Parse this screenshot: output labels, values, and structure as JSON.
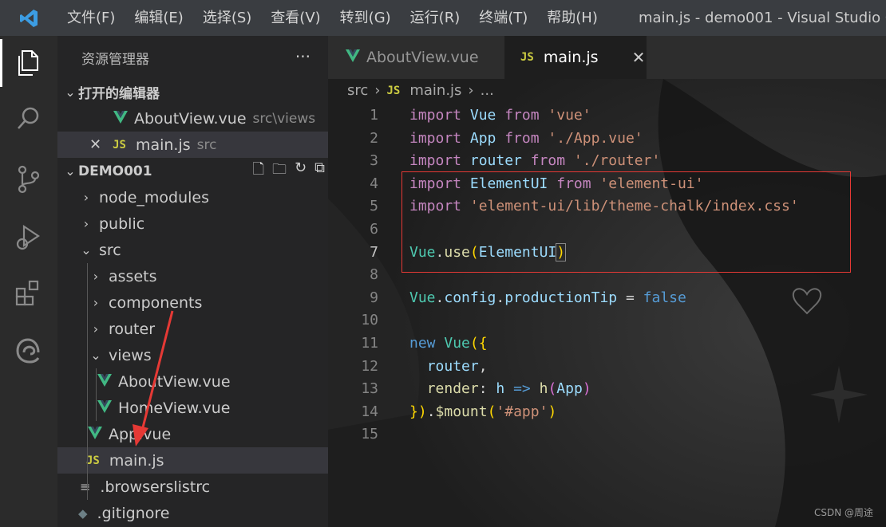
{
  "titlebar": {
    "menus": [
      "文件(F)",
      "编辑(E)",
      "选择(S)",
      "查看(V)",
      "转到(G)",
      "运行(R)",
      "终端(T)",
      "帮助(H)"
    ],
    "title": "main.js - demo001 - Visual Studio Code"
  },
  "activity_bar": {
    "icons": [
      "explorer-icon",
      "search-icon",
      "source-control-icon",
      "run-debug-icon",
      "extensions-icon",
      "edge-icon"
    ]
  },
  "sidebar": {
    "header": "资源管理器",
    "more": "···",
    "open_editors": {
      "title": "打开的编辑器",
      "items": [
        {
          "name": "AboutView.vue",
          "path": "src\\views"
        },
        {
          "name": "main.js",
          "path": "src"
        }
      ]
    },
    "project": {
      "title": "DEMO001",
      "tree": [
        {
          "label": "node_modules",
          "type": "folder",
          "state": "collapsed"
        },
        {
          "label": "public",
          "type": "folder",
          "state": "collapsed"
        },
        {
          "label": "src",
          "type": "folder",
          "state": "expanded"
        },
        {
          "label": "assets",
          "type": "folder",
          "state": "collapsed"
        },
        {
          "label": "components",
          "type": "folder",
          "state": "collapsed"
        },
        {
          "label": "router",
          "type": "folder",
          "state": "collapsed"
        },
        {
          "label": "views",
          "type": "folder",
          "state": "expanded"
        },
        {
          "label": "AboutView.vue",
          "type": "vue"
        },
        {
          "label": "HomeView.vue",
          "type": "vue"
        },
        {
          "label": "App.vue",
          "type": "vue"
        },
        {
          "label": "main.js",
          "type": "js"
        },
        {
          "label": ".browserslistrc",
          "type": "file"
        },
        {
          "label": ".gitignore",
          "type": "git"
        }
      ]
    }
  },
  "tabs": [
    {
      "label": "AboutView.vue",
      "active": false
    },
    {
      "label": "main.js",
      "active": true,
      "close": "✕"
    }
  ],
  "breadcrumb": {
    "folder": "src",
    "file": "main.js",
    "tail": "..."
  },
  "code_lines": [
    {
      "n": "1",
      "tokens": [
        [
          "kw",
          "import "
        ],
        [
          "vb",
          "Vue "
        ],
        [
          "kw",
          "from "
        ],
        [
          "str",
          "'vue'"
        ]
      ]
    },
    {
      "n": "2",
      "tokens": [
        [
          "kw",
          "import "
        ],
        [
          "vb",
          "App "
        ],
        [
          "kw",
          "from "
        ],
        [
          "str",
          "'./App.vue'"
        ]
      ]
    },
    {
      "n": "3",
      "tokens": [
        [
          "kw",
          "import "
        ],
        [
          "vb",
          "router "
        ],
        [
          "kw",
          "from "
        ],
        [
          "str",
          "'./router'"
        ]
      ]
    },
    {
      "n": "4",
      "tokens": [
        [
          "kw",
          "import "
        ],
        [
          "vb",
          "ElementUI "
        ],
        [
          "kw",
          "from "
        ],
        [
          "str",
          "'element-ui'"
        ]
      ]
    },
    {
      "n": "5",
      "tokens": [
        [
          "kw",
          "import "
        ],
        [
          "str",
          "'element-ui/lib/theme-chalk/index.css'"
        ]
      ]
    },
    {
      "n": "6",
      "tokens": []
    },
    {
      "n": "7",
      "tokens": [
        [
          "cls",
          "Vue"
        ],
        [
          "pn",
          "."
        ],
        [
          "fn",
          "use"
        ],
        [
          "br",
          "("
        ],
        [
          "vb",
          "ElementUI"
        ],
        [
          "br",
          "@)"
        ]
      ]
    },
    {
      "n": "8",
      "tokens": []
    },
    {
      "n": "9",
      "tokens": [
        [
          "cls",
          "Vue"
        ],
        [
          "pn",
          "."
        ],
        [
          "vb",
          "config"
        ],
        [
          "pn",
          "."
        ],
        [
          "vb",
          "productionTip"
        ],
        [
          "pn",
          " = "
        ],
        [
          "bl",
          "false"
        ]
      ]
    },
    {
      "n": "10",
      "tokens": []
    },
    {
      "n": "11",
      "tokens": [
        [
          "bl",
          "new "
        ],
        [
          "cls",
          "Vue"
        ],
        [
          "br",
          "({"
        ]
      ]
    },
    {
      "n": "12",
      "tokens": [
        [
          "pn",
          "  "
        ],
        [
          "vb",
          "router"
        ],
        [
          "pn",
          ","
        ]
      ]
    },
    {
      "n": "13",
      "tokens": [
        [
          "pn",
          "  "
        ],
        [
          "fn",
          "render"
        ],
        [
          "pn",
          ": "
        ],
        [
          "vb",
          "h "
        ],
        [
          "bl",
          "=> "
        ],
        [
          "fn",
          "h"
        ],
        [
          "br2",
          "("
        ],
        [
          "vb",
          "App"
        ],
        [
          "br2",
          ")"
        ]
      ]
    },
    {
      "n": "14",
      "tokens": [
        [
          "br",
          "})"
        ],
        [
          "pn",
          "."
        ],
        [
          "fn",
          "$mount"
        ],
        [
          "br",
          "("
        ],
        [
          "str",
          "'#app'"
        ],
        [
          "br",
          ")"
        ]
      ]
    },
    {
      "n": "15",
      "tokens": []
    }
  ],
  "active_line": "7",
  "watermark": "CSDN @周途",
  "colors": {
    "highlight_box": "#e53935",
    "annotation_arrow": "#e53935",
    "vue_green": "#41b883",
    "js_yellow": "#cbcb41"
  }
}
